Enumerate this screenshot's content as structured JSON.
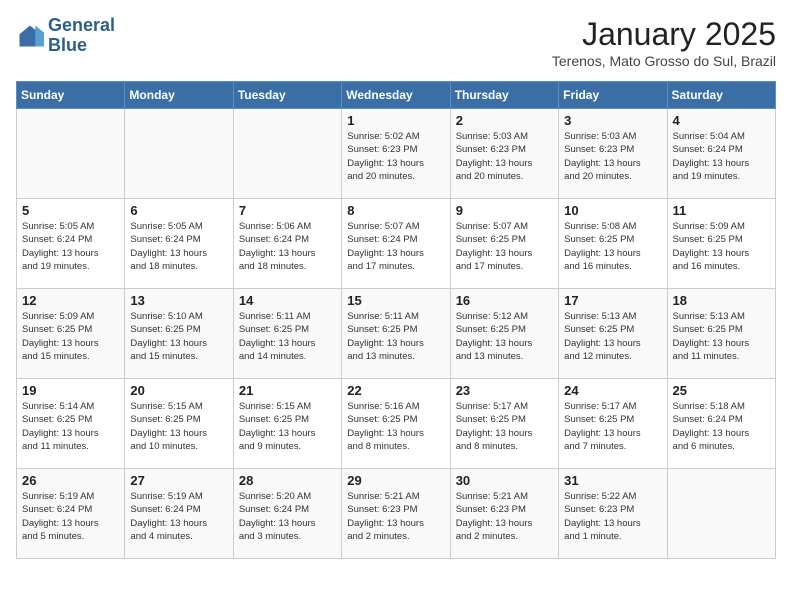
{
  "header": {
    "logo_line1": "General",
    "logo_line2": "Blue",
    "month": "January 2025",
    "location": "Terenos, Mato Grosso do Sul, Brazil"
  },
  "weekdays": [
    "Sunday",
    "Monday",
    "Tuesday",
    "Wednesday",
    "Thursday",
    "Friday",
    "Saturday"
  ],
  "weeks": [
    [
      {
        "day": "",
        "info": ""
      },
      {
        "day": "",
        "info": ""
      },
      {
        "day": "",
        "info": ""
      },
      {
        "day": "1",
        "info": "Sunrise: 5:02 AM\nSunset: 6:23 PM\nDaylight: 13 hours\nand 20 minutes."
      },
      {
        "day": "2",
        "info": "Sunrise: 5:03 AM\nSunset: 6:23 PM\nDaylight: 13 hours\nand 20 minutes."
      },
      {
        "day": "3",
        "info": "Sunrise: 5:03 AM\nSunset: 6:23 PM\nDaylight: 13 hours\nand 20 minutes."
      },
      {
        "day": "4",
        "info": "Sunrise: 5:04 AM\nSunset: 6:24 PM\nDaylight: 13 hours\nand 19 minutes."
      }
    ],
    [
      {
        "day": "5",
        "info": "Sunrise: 5:05 AM\nSunset: 6:24 PM\nDaylight: 13 hours\nand 19 minutes."
      },
      {
        "day": "6",
        "info": "Sunrise: 5:05 AM\nSunset: 6:24 PM\nDaylight: 13 hours\nand 18 minutes."
      },
      {
        "day": "7",
        "info": "Sunrise: 5:06 AM\nSunset: 6:24 PM\nDaylight: 13 hours\nand 18 minutes."
      },
      {
        "day": "8",
        "info": "Sunrise: 5:07 AM\nSunset: 6:24 PM\nDaylight: 13 hours\nand 17 minutes."
      },
      {
        "day": "9",
        "info": "Sunrise: 5:07 AM\nSunset: 6:25 PM\nDaylight: 13 hours\nand 17 minutes."
      },
      {
        "day": "10",
        "info": "Sunrise: 5:08 AM\nSunset: 6:25 PM\nDaylight: 13 hours\nand 16 minutes."
      },
      {
        "day": "11",
        "info": "Sunrise: 5:09 AM\nSunset: 6:25 PM\nDaylight: 13 hours\nand 16 minutes."
      }
    ],
    [
      {
        "day": "12",
        "info": "Sunrise: 5:09 AM\nSunset: 6:25 PM\nDaylight: 13 hours\nand 15 minutes."
      },
      {
        "day": "13",
        "info": "Sunrise: 5:10 AM\nSunset: 6:25 PM\nDaylight: 13 hours\nand 15 minutes."
      },
      {
        "day": "14",
        "info": "Sunrise: 5:11 AM\nSunset: 6:25 PM\nDaylight: 13 hours\nand 14 minutes."
      },
      {
        "day": "15",
        "info": "Sunrise: 5:11 AM\nSunset: 6:25 PM\nDaylight: 13 hours\nand 13 minutes."
      },
      {
        "day": "16",
        "info": "Sunrise: 5:12 AM\nSunset: 6:25 PM\nDaylight: 13 hours\nand 13 minutes."
      },
      {
        "day": "17",
        "info": "Sunrise: 5:13 AM\nSunset: 6:25 PM\nDaylight: 13 hours\nand 12 minutes."
      },
      {
        "day": "18",
        "info": "Sunrise: 5:13 AM\nSunset: 6:25 PM\nDaylight: 13 hours\nand 11 minutes."
      }
    ],
    [
      {
        "day": "19",
        "info": "Sunrise: 5:14 AM\nSunset: 6:25 PM\nDaylight: 13 hours\nand 11 minutes."
      },
      {
        "day": "20",
        "info": "Sunrise: 5:15 AM\nSunset: 6:25 PM\nDaylight: 13 hours\nand 10 minutes."
      },
      {
        "day": "21",
        "info": "Sunrise: 5:15 AM\nSunset: 6:25 PM\nDaylight: 13 hours\nand 9 minutes."
      },
      {
        "day": "22",
        "info": "Sunrise: 5:16 AM\nSunset: 6:25 PM\nDaylight: 13 hours\nand 8 minutes."
      },
      {
        "day": "23",
        "info": "Sunrise: 5:17 AM\nSunset: 6:25 PM\nDaylight: 13 hours\nand 8 minutes."
      },
      {
        "day": "24",
        "info": "Sunrise: 5:17 AM\nSunset: 6:25 PM\nDaylight: 13 hours\nand 7 minutes."
      },
      {
        "day": "25",
        "info": "Sunrise: 5:18 AM\nSunset: 6:24 PM\nDaylight: 13 hours\nand 6 minutes."
      }
    ],
    [
      {
        "day": "26",
        "info": "Sunrise: 5:19 AM\nSunset: 6:24 PM\nDaylight: 13 hours\nand 5 minutes."
      },
      {
        "day": "27",
        "info": "Sunrise: 5:19 AM\nSunset: 6:24 PM\nDaylight: 13 hours\nand 4 minutes."
      },
      {
        "day": "28",
        "info": "Sunrise: 5:20 AM\nSunset: 6:24 PM\nDaylight: 13 hours\nand 3 minutes."
      },
      {
        "day": "29",
        "info": "Sunrise: 5:21 AM\nSunset: 6:23 PM\nDaylight: 13 hours\nand 2 minutes."
      },
      {
        "day": "30",
        "info": "Sunrise: 5:21 AM\nSunset: 6:23 PM\nDaylight: 13 hours\nand 2 minutes."
      },
      {
        "day": "31",
        "info": "Sunrise: 5:22 AM\nSunset: 6:23 PM\nDaylight: 13 hours\nand 1 minute."
      },
      {
        "day": "",
        "info": ""
      }
    ]
  ]
}
